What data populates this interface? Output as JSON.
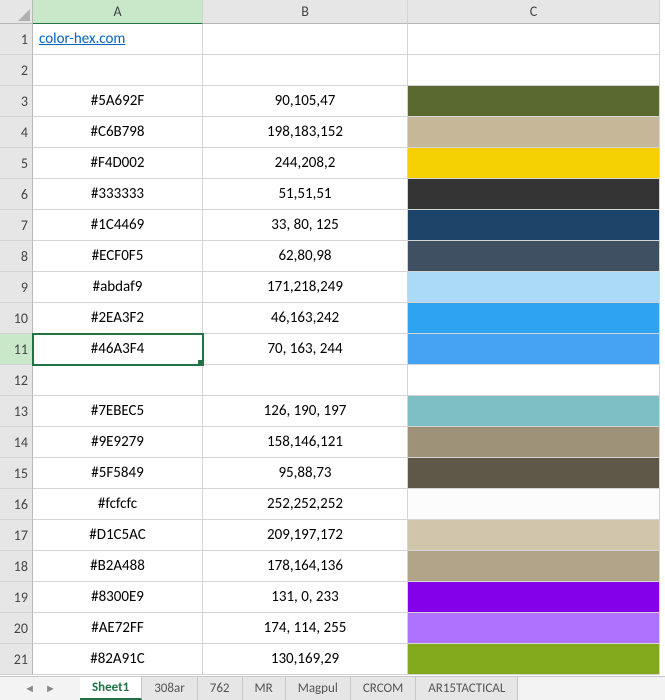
{
  "columns": [
    "A",
    "B",
    "C"
  ],
  "link_text": "color-hex.com",
  "active_cell": {
    "row": 11,
    "col": "A"
  },
  "rows": [
    {
      "n": 1,
      "hex": "",
      "rgb": "",
      "color": "",
      "link": true
    },
    {
      "n": 2,
      "hex": "",
      "rgb": "",
      "color": ""
    },
    {
      "n": 3,
      "hex": "#5A692F",
      "rgb": "90,105,47",
      "color": "#5A692F"
    },
    {
      "n": 4,
      "hex": "#C6B798",
      "rgb": "198,183,152",
      "color": "#C6B798"
    },
    {
      "n": 5,
      "hex": "#F4D002",
      "rgb": "244,208,2",
      "color": "#F4D002"
    },
    {
      "n": 6,
      "hex": "#333333",
      "rgb": "51,51,51",
      "color": "#333333"
    },
    {
      "n": 7,
      "hex": "#1C4469",
      "rgb": "33, 80, 125",
      "color": "#1C4469"
    },
    {
      "n": 8,
      "hex": "#ECF0F5",
      "rgb": "62,80,98",
      "color": "#3E5062"
    },
    {
      "n": 9,
      "hex": "#abdaf9",
      "rgb": "171,218,249",
      "color": "#abdaf9"
    },
    {
      "n": 10,
      "hex": "#2EA3F2",
      "rgb": "46,163,242",
      "color": "#2EA3F2"
    },
    {
      "n": 11,
      "hex": "#46A3F4",
      "rgb": "70, 163, 244",
      "color": "#46A3F4"
    },
    {
      "n": 12,
      "hex": "",
      "rgb": "",
      "color": ""
    },
    {
      "n": 13,
      "hex": "#7EBEC5",
      "rgb": "126, 190, 197",
      "color": "#7EBEC5"
    },
    {
      "n": 14,
      "hex": "#9E9279",
      "rgb": "158,146,121",
      "color": "#9E9279"
    },
    {
      "n": 15,
      "hex": "#5F5849",
      "rgb": "95,88,73",
      "color": "#5F5849"
    },
    {
      "n": 16,
      "hex": "#fcfcfc",
      "rgb": "252,252,252",
      "color": "#fcfcfc"
    },
    {
      "n": 17,
      "hex": "#D1C5AC",
      "rgb": "209,197,172",
      "color": "#D1C5AC"
    },
    {
      "n": 18,
      "hex": "#B2A488",
      "rgb": "178,164,136",
      "color": "#B2A488"
    },
    {
      "n": 19,
      "hex": "#8300E9",
      "rgb": "131, 0, 233",
      "color": "#8300E9"
    },
    {
      "n": 20,
      "hex": "#AE72FF",
      "rgb": "174, 114, 255",
      "color": "#AE72FF"
    },
    {
      "n": 21,
      "hex": "#82A91C",
      "rgb": "130,169,29",
      "color": "#82A91C"
    }
  ],
  "tabs": {
    "active": "Sheet1",
    "items": [
      "Sheet1",
      "308ar",
      "762",
      "MR",
      "Magpul",
      "CRCOM",
      "AR15TACTICAL"
    ]
  }
}
